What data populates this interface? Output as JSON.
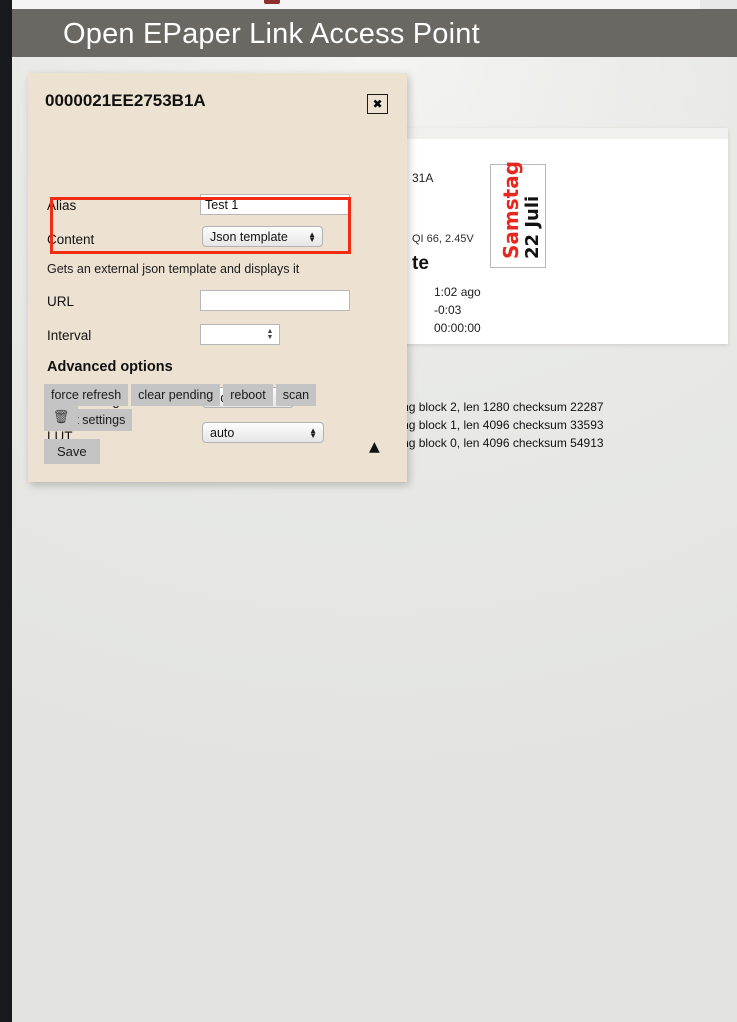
{
  "header": {
    "title": "Open EPaper Link Access Point"
  },
  "dialog": {
    "title": "0000021EE2753B1A",
    "close_label": "✖",
    "fields": {
      "alias": {
        "label": "Alias",
        "value": "Test 1",
        "placeholder": ""
      },
      "content": {
        "label": "Content",
        "value": "Json template",
        "options": [
          "Json template"
        ]
      },
      "url": {
        "label": "URL",
        "value": "",
        "placeholder": ""
      },
      "interval": {
        "label": "Interval",
        "value": "",
        "placeholder": ""
      },
      "rotate_image": {
        "label": "Rotate image",
        "value": "0 degrees",
        "options": [
          "0 degrees"
        ]
      },
      "lut": {
        "label": "LUT",
        "value": "auto",
        "options": [
          "auto"
        ]
      }
    },
    "content_description": "Gets an external json template and displays it",
    "advanced_options_heading": "Advanced options",
    "action_buttons": [
      "force refresh",
      "clear pending",
      "reboot",
      "scan",
      "reset settings"
    ],
    "delete_label": "🗑",
    "save_label": "Save",
    "scroll_top_label": "▲"
  },
  "device_card": {
    "device_id_fragment": "31A",
    "signal": "QI 66, 2.45V",
    "heading_fragment": "te",
    "times": [
      "1:02 ago",
      "-0:03",
      "00:00:00"
    ],
    "preview": {
      "day": "Samstag",
      "date": "22 Juli"
    }
  },
  "log": {
    "lines": [
      "E2753B1A.pending block 2, len 1280 checksum 22287",
      "E2753B1A.pending block 1, len 4096 checksum 33593",
      "E2753B1A.pending block 0, len 4096 checksum 54913"
    ]
  },
  "annotation": {
    "color": "#f22c12"
  }
}
